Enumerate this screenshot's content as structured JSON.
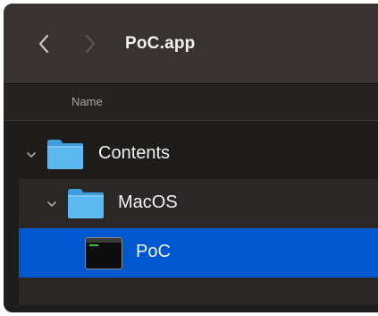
{
  "toolbar": {
    "title": "PoC.app",
    "back_icon": "chevron-left-icon",
    "forward_icon": "chevron-right-icon"
  },
  "header": {
    "name_column": "Name"
  },
  "rows": [
    {
      "label": "Contents",
      "icon": "folder-icon",
      "expanded": true,
      "level": 0
    },
    {
      "label": "MacOS",
      "icon": "folder-icon",
      "expanded": true,
      "level": 1
    },
    {
      "label": "PoC",
      "icon": "terminal-executable-icon",
      "selected": true,
      "level": 2
    }
  ],
  "colors": {
    "selection": "#0058d0",
    "folder": "#5bb8f0",
    "window_bg": "#1f1d1c",
    "toolbar_bg": "#383331"
  }
}
